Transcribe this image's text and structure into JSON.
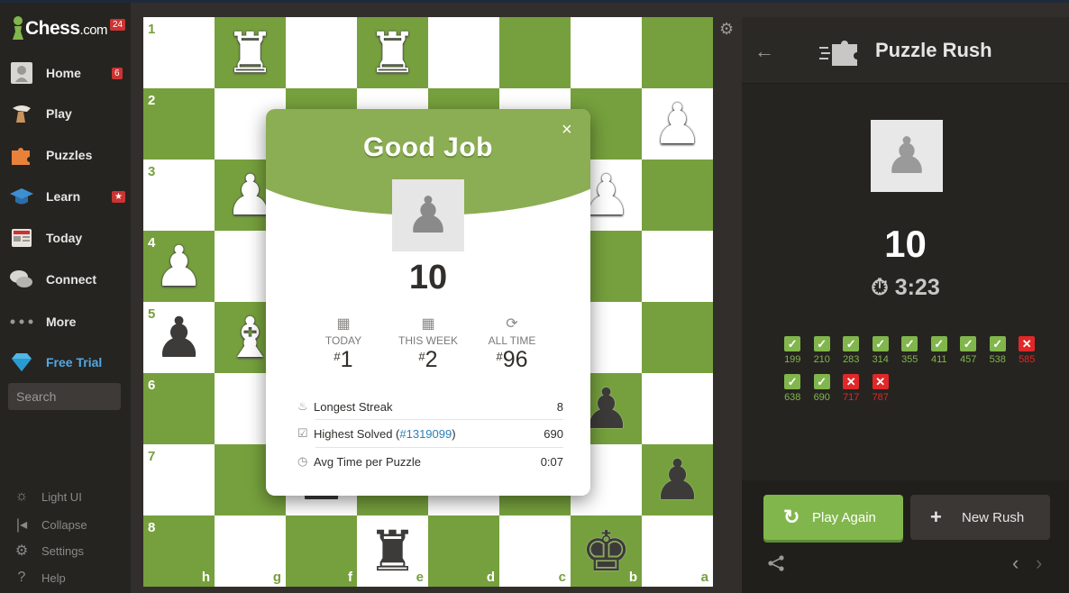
{
  "sidebar": {
    "logo_main": "Chess",
    "logo_suffix": ".com",
    "logo_badge": "24",
    "items": [
      {
        "label": "Home",
        "badge": "6"
      },
      {
        "label": "Play"
      },
      {
        "label": "Puzzles"
      },
      {
        "label": "Learn",
        "badge": "★"
      },
      {
        "label": "Today"
      },
      {
        "label": "Connect"
      },
      {
        "label": "More"
      },
      {
        "label": "Free Trial"
      }
    ],
    "search_placeholder": "Search",
    "bottom": [
      {
        "icon": "☼",
        "label": "Light UI"
      },
      {
        "icon": "|◂",
        "label": "Collapse"
      },
      {
        "icon": "⚙",
        "label": "Settings"
      },
      {
        "icon": "?",
        "label": "Help"
      }
    ]
  },
  "board": {
    "ranks": [
      "1",
      "2",
      "3",
      "4",
      "5",
      "6",
      "7",
      "8"
    ],
    "files": [
      "h",
      "g",
      "f",
      "e",
      "d",
      "c",
      "b",
      "a"
    ],
    "pieces": [
      {
        "row": 0,
        "col": 1,
        "glyph": "♜",
        "color": "w",
        "name": "white-rook"
      },
      {
        "row": 0,
        "col": 3,
        "glyph": "♜",
        "color": "w",
        "name": "white-rook"
      },
      {
        "row": 1,
        "col": 7,
        "glyph": "♟",
        "color": "w",
        "name": "white-pawn"
      },
      {
        "row": 2,
        "col": 1,
        "glyph": "♟",
        "color": "w",
        "name": "white-pawn"
      },
      {
        "row": 2,
        "col": 6,
        "glyph": "♟",
        "color": "w",
        "name": "white-pawn"
      },
      {
        "row": 3,
        "col": 0,
        "glyph": "♟",
        "color": "w",
        "name": "white-pawn"
      },
      {
        "row": 4,
        "col": 0,
        "glyph": "♟",
        "color": "b",
        "name": "black-pawn"
      },
      {
        "row": 4,
        "col": 1,
        "glyph": "♝",
        "color": "w",
        "name": "white-bishop"
      },
      {
        "row": 5,
        "col": 6,
        "glyph": "♟",
        "color": "b",
        "name": "black-pawn"
      },
      {
        "row": 6,
        "col": 2,
        "glyph": "♟",
        "color": "b",
        "name": "black-pawn"
      },
      {
        "row": 6,
        "col": 7,
        "glyph": "♟",
        "color": "b",
        "name": "black-pawn"
      },
      {
        "row": 7,
        "col": 3,
        "glyph": "♜",
        "color": "b",
        "name": "black-rook"
      },
      {
        "row": 7,
        "col": 6,
        "glyph": "♚",
        "color": "b",
        "name": "black-king"
      }
    ]
  },
  "modal": {
    "title": "Good Job",
    "close": "×",
    "pawn_glyph": "♟",
    "score": "10",
    "stats": [
      {
        "icon": "▦",
        "label": "TODAY",
        "hash": "#",
        "value": "1"
      },
      {
        "icon": "▦",
        "label": "THIS WEEK",
        "hash": "#",
        "value": "2"
      },
      {
        "icon": "⟳",
        "label": "ALL TIME",
        "hash": "#",
        "value": "96"
      }
    ],
    "rows": [
      {
        "icon": "♨",
        "label": "Longest Streak",
        "value": "8"
      },
      {
        "icon": "☑",
        "label": "Highest Solved (",
        "link": "#1319099",
        "label_end": ")",
        "value": "690"
      },
      {
        "icon": "◷",
        "label": "Avg Time per Puzzle",
        "value": "0:07"
      }
    ]
  },
  "panel": {
    "back": "←",
    "title": "Puzzle Rush",
    "pawn_glyph": "♟",
    "score": "10",
    "timer_icon": "⏱",
    "timer": "3:23",
    "results": [
      {
        "ok": true,
        "value": "199"
      },
      {
        "ok": true,
        "value": "210"
      },
      {
        "ok": true,
        "value": "283"
      },
      {
        "ok": true,
        "value": "314"
      },
      {
        "ok": true,
        "value": "355"
      },
      {
        "ok": true,
        "value": "411"
      },
      {
        "ok": true,
        "value": "457"
      },
      {
        "ok": true,
        "value": "538"
      },
      {
        "ok": false,
        "value": "585"
      },
      {
        "ok": true,
        "value": "638"
      },
      {
        "ok": true,
        "value": "690"
      },
      {
        "ok": false,
        "value": "717"
      },
      {
        "ok": false,
        "value": "787"
      }
    ],
    "play_again": "Play Again",
    "play_again_icon": "↻",
    "new_rush": "New Rush",
    "new_rush_icon": "+",
    "share_icon": "⋖",
    "prev": "‹",
    "next": "›"
  },
  "colors": {
    "board_light": "#ffffff",
    "board_dark": "#76a03d",
    "accent_green": "#81b64c",
    "error_red": "#e02828"
  }
}
